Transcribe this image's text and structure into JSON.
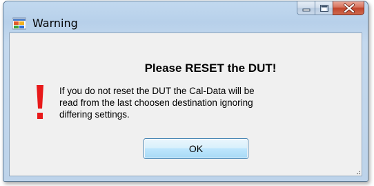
{
  "window": {
    "title": "Warning",
    "app_icon": "windows-form-icon",
    "caption_buttons": [
      "minimize",
      "maximize",
      "close"
    ]
  },
  "dialog": {
    "heading": "Please RESET the DUT!",
    "message": "If you do not reset the DUT the Cal-Data will be read from the last choosen destination ignoring differing settings.",
    "warning_icon": "exclamation-icon",
    "ok_label": "OK"
  },
  "colors": {
    "accent_red": "#e8191a",
    "button_border": "#3c7fb1",
    "frame": "#b9d1ea"
  }
}
